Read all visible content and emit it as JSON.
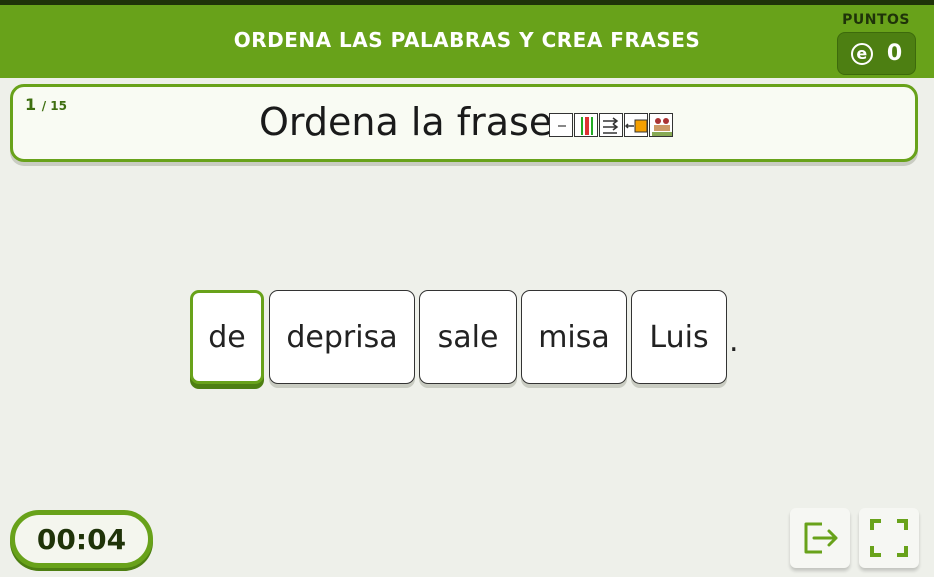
{
  "header": {
    "title": "ORDENA LAS PALABRAS Y CREA FRASES",
    "points_label": "PUNTOS",
    "points_icon": "coin-icon",
    "points_symbol": "e",
    "points_value": "0"
  },
  "question": {
    "current": "1",
    "total": "/ 15",
    "text": "Ordena la frase",
    "pictograms": [
      "pictogram-ordena",
      "pictogram-la",
      "pictogram-frase-1",
      "pictogram-frase-2",
      "pictogram-frase-3"
    ]
  },
  "words": [
    {
      "label": "de",
      "selected": true
    },
    {
      "label": "deprisa",
      "selected": false
    },
    {
      "label": "sale",
      "selected": false
    },
    {
      "label": "misa",
      "selected": false
    },
    {
      "label": "Luis",
      "selected": false
    }
  ],
  "sentence_end": ".",
  "timer": "00:04",
  "buttons": {
    "exit_icon": "exit-icon",
    "fullscreen_icon": "fullscreen-icon"
  },
  "colors": {
    "primary": "#68a21a",
    "dark": "#1f3309",
    "background": "#eef0ea"
  }
}
